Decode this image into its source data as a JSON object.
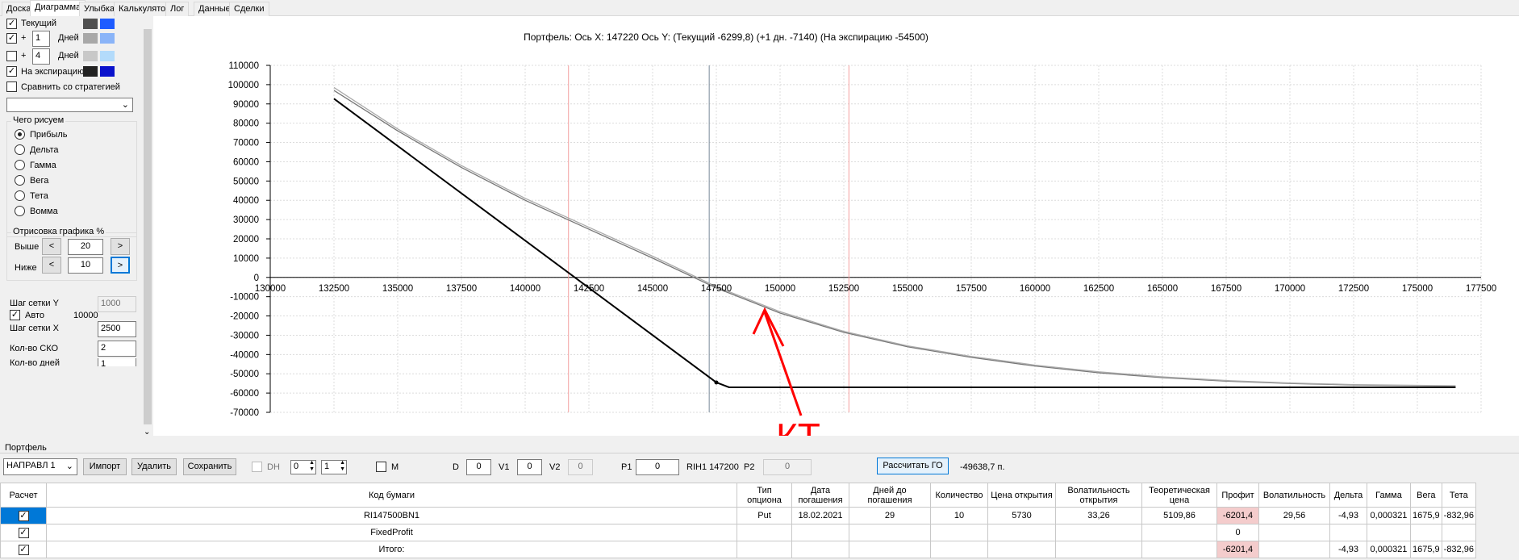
{
  "tabs": [
    "Доска",
    "Диаграмма",
    "Улыбка",
    "Калькулятор",
    "Лог",
    "Данные",
    "Сделки"
  ],
  "left": {
    "current_label": "Текущий",
    "plus": "+",
    "days1": "1",
    "days_label": "Дней",
    "days2": "4",
    "expiry_label": "На экспирацию",
    "compare_label": "Сравнить со стратегией",
    "draw_group": "Чего рисуем",
    "radios": [
      "Прибыль",
      "Дельта",
      "Гамма",
      "Вега",
      "Тета",
      "Вомма"
    ],
    "render_group": "Отрисовка графика %",
    "above_label": "Выше",
    "above_value": "20",
    "below_label": "Ниже",
    "below_value": "10",
    "btn_left": "<",
    "btn_right": ">",
    "grid_y_label": "Шаг сетки Y",
    "grid_y_value": "1000",
    "auto_label": "Авто",
    "auto_value": "10000",
    "grid_x_label": "Шаг сетки X",
    "grid_x_value": "2500",
    "sko_label": "Кол-во СКО",
    "sko_value": "2",
    "days_cnt_label": "Кол-во дней",
    "days_cnt_value": "1",
    "colors": {
      "current_dark": "#505050",
      "current_blue": "#1e5cff",
      "d1_gray": "#a8a8a8",
      "d1_blue": "#8ab4f8",
      "d4_gray": "#c8c8c8",
      "d4_blue": "#b3dbfb",
      "exp_dark": "#222222",
      "exp_blue": "#0a12cc"
    }
  },
  "chart_title": "Портфель: Ось X: 147220 Ось Y:  (Текущий -6299,8)  (+1 дн. -7140)  (На экспирацию -54500)",
  "annotation": "КТ",
  "chart_data": {
    "type": "line",
    "x_ticks": [
      130000,
      132500,
      135000,
      137500,
      140000,
      142500,
      145000,
      147500,
      150000,
      152500,
      155000,
      157500,
      160000,
      162500,
      165000,
      167500,
      170000,
      172500,
      175000,
      177500
    ],
    "y_ticks": [
      110000,
      100000,
      90000,
      80000,
      70000,
      60000,
      50000,
      40000,
      30000,
      20000,
      10000,
      0,
      -10000,
      -20000,
      -30000,
      -40000,
      -50000,
      -60000,
      -70000
    ],
    "xlim": [
      130000,
      177500
    ],
    "ylim": [
      -70000,
      110000
    ],
    "current_x": 147220,
    "sko_lines": [
      141700,
      152700
    ],
    "series": [
      {
        "name": "Текущий",
        "color": "#777777",
        "x": [
          132500,
          135000,
          137500,
          140000,
          142500,
          145000,
          147500,
          150000,
          152500,
          155000,
          157500,
          160000,
          162500,
          165000,
          167500,
          170000,
          172500,
          175000,
          176500
        ],
        "y": [
          97000,
          76000,
          57000,
          40000,
          25000,
          10000,
          -5500,
          -18500,
          -28500,
          -36000,
          -41500,
          -46000,
          -49500,
          -52000,
          -53800,
          -55000,
          -55800,
          -56200,
          -56400
        ]
      },
      {
        "name": "+1 дн.",
        "color": "#aaaaaa",
        "x": [
          132500,
          135000,
          137500,
          140000,
          142500,
          145000,
          147500,
          150000,
          152500,
          155000,
          157500,
          160000,
          162500,
          165000,
          167500,
          170000,
          172500,
          175000,
          176500
        ],
        "y": [
          98500,
          77000,
          58000,
          41000,
          26000,
          11000,
          -4800,
          -17800,
          -28000,
          -35500,
          -41000,
          -45500,
          -49000,
          -51600,
          -53500,
          -54800,
          -55600,
          -56000,
          -56200
        ]
      },
      {
        "name": "На экспирацию",
        "color": "#000000",
        "x": [
          132500,
          147500,
          148000,
          176500
        ],
        "y": [
          92700,
          -54500,
          -57000,
          -57000
        ]
      }
    ]
  },
  "portfolio": {
    "label": "Портфель",
    "select_value": "НАПРАВЛ 1",
    "import": "Импорт",
    "delete": "Удалить",
    "save": "Сохранить",
    "dh": "DH",
    "spin1": "0",
    "spin2": "1",
    "m": "M",
    "d_label": "D",
    "d_value": "0",
    "v1_label": "V1",
    "v1_value": "0",
    "v2_label": "V2",
    "v2_value": "0",
    "p1_label": "P1",
    "p1_value": "0",
    "rih": "RIH1 147200",
    "p2_label": "P2",
    "p2_value": "0",
    "calc": "Рассчитать ГО",
    "go_value": "-49638,7 п."
  },
  "table": {
    "headers": [
      "Расчет",
      "Код бумаги",
      "Тип опциона",
      "Дата погашения",
      "Дней до погашения",
      "Количество",
      "Цена открытия",
      "Волатильность открытия",
      "Теоретическая цена",
      "Профит",
      "Волатильность",
      "Дельта",
      "Гамма",
      "Вега",
      "Тета"
    ],
    "rows": [
      [
        "",
        "RI147500BN1",
        "Put",
        "18.02.2021",
        "29",
        "10",
        "5730",
        "33,26",
        "5109,86",
        "-6201,4",
        "29,56",
        "-4,93",
        "0,000321",
        "1675,9",
        "-832,96"
      ],
      [
        "",
        "FixedProfit",
        "",
        "",
        "",
        "",
        "",
        "",
        "",
        "0",
        "",
        "",
        "",
        "",
        ""
      ],
      [
        "",
        "Итого:",
        "",
        "",
        "",
        "",
        "",
        "",
        "",
        "-6201,4",
        "",
        "-4,93",
        "0,000321",
        "1675,9",
        "-832,96"
      ]
    ]
  }
}
